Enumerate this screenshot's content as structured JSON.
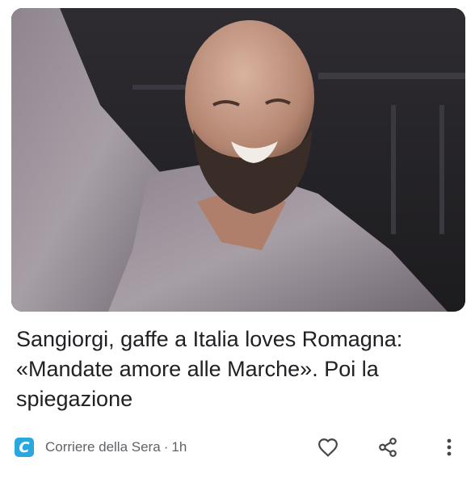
{
  "article": {
    "image_alt": "Bald bearded man smiling with raised arm",
    "headline": "Sangiorgi, gaffe a Italia loves Romagna: «Mandate amore alle Marche». Poi la spiegazione",
    "source_logo_letter": "C",
    "source_name": "Corriere della Sera",
    "separator": "·",
    "time_ago": "1h"
  },
  "icons": {
    "like": "heart-outline-icon",
    "share": "share-icon",
    "more": "more-vert-icon"
  },
  "colors": {
    "text_primary": "#202124",
    "text_secondary": "#5f6368",
    "source_logo_bg": "#2aa7de"
  }
}
